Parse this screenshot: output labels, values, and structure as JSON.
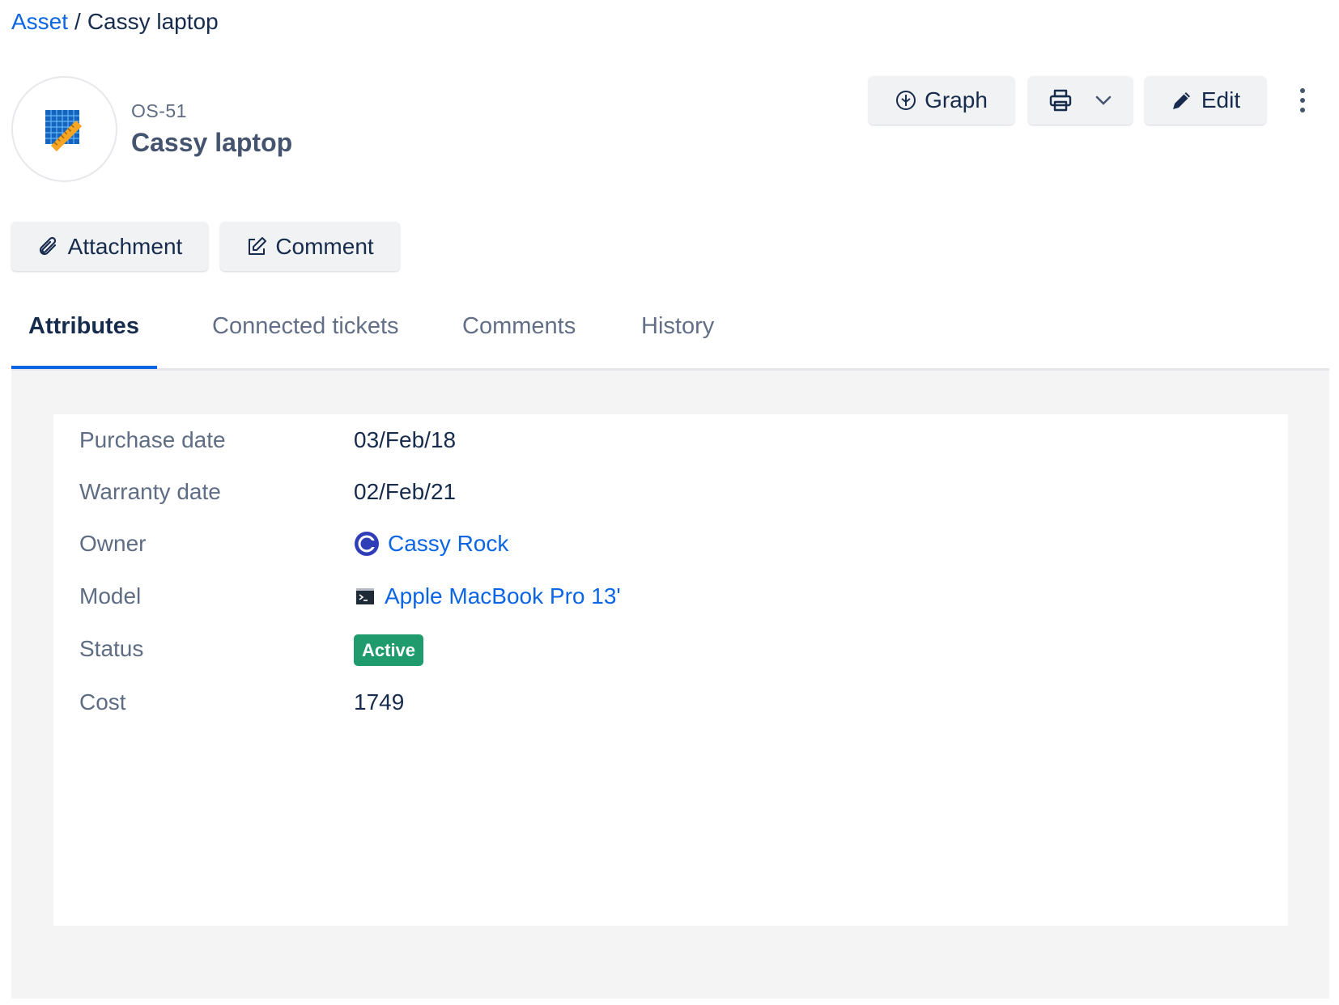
{
  "breadcrumb": {
    "parent": "Asset",
    "separator": "/",
    "current": "Cassy laptop"
  },
  "asset": {
    "key": "OS-51",
    "name": "Cassy laptop",
    "icon": "blueprint-ruler-icon"
  },
  "toolbar": {
    "graph_label": "Graph",
    "edit_label": "Edit"
  },
  "actions": {
    "attachment_label": "Attachment",
    "comment_label": "Comment"
  },
  "tabs": [
    {
      "label": "Attributes",
      "active": true
    },
    {
      "label": "Connected tickets",
      "active": false
    },
    {
      "label": "Comments",
      "active": false
    },
    {
      "label": "History",
      "active": false
    }
  ],
  "attributes": {
    "purchase_date": {
      "label": "Purchase date",
      "value": "03/Feb/18"
    },
    "warranty_date": {
      "label": "Warranty date",
      "value": "02/Feb/21"
    },
    "owner": {
      "label": "Owner",
      "value": "Cassy Rock",
      "icon": "user-avatar-icon"
    },
    "model": {
      "label": "Model",
      "value": "Apple MacBook Pro 13'",
      "icon": "terminal-icon"
    },
    "status": {
      "label": "Status",
      "value": "Active",
      "color": "#1f9b6e"
    },
    "cost": {
      "label": "Cost",
      "value": "1749"
    }
  },
  "colors": {
    "link": "#0c66e4",
    "active_tab": "#0c66e4",
    "panel_bg": "#f4f4f4"
  }
}
